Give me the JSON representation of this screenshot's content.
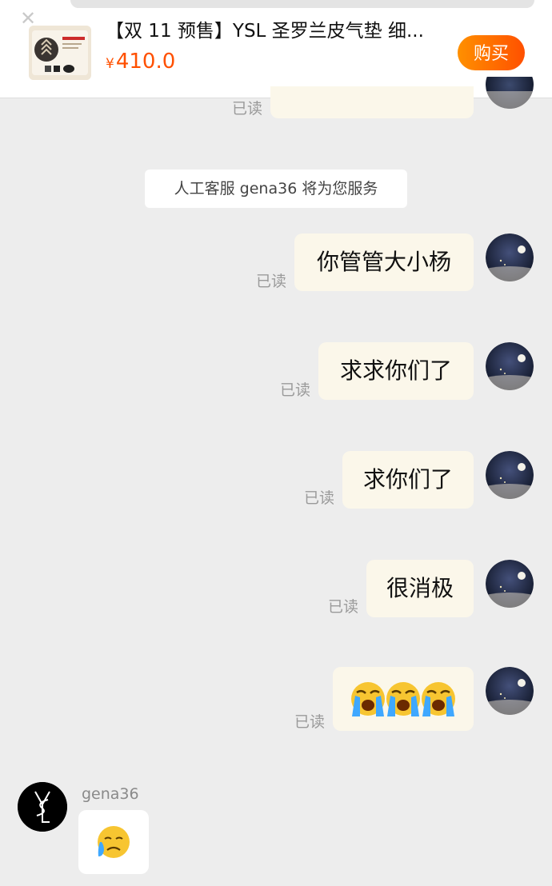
{
  "product": {
    "title": "【双 11 预售】YSL 圣罗兰皮气垫 细...",
    "currency": "¥",
    "price": "410.0",
    "buy_label": "购买",
    "price_color": "#ff5000",
    "close_icon": "close-icon"
  },
  "system_notice": "人工客服 gena36 将为您服务",
  "read_label": "已读",
  "messages": [
    {
      "text": "你管管大小杨"
    },
    {
      "text": "求求你们了"
    },
    {
      "text": "求你们了"
    },
    {
      "text": "很消极"
    },
    {
      "emoji": "loudly-crying-face-x3"
    }
  ],
  "agent": {
    "name": "gena36",
    "reply_emoji": "crying-face"
  },
  "colors": {
    "background": "#ededed",
    "user_bubble": "#fbf7ea",
    "agent_bubble": "#ffffff",
    "buy_button_start": "#ff9000",
    "buy_button_end": "#ff5000"
  }
}
